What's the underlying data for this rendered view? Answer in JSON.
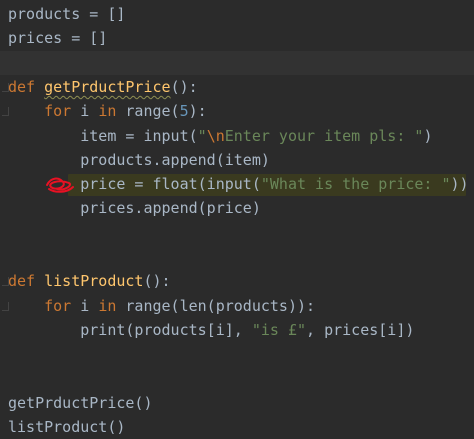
{
  "editor": {
    "lines": [
      {
        "id": "l1",
        "tokens": [
          {
            "t": "products = []",
            "c": "plain"
          }
        ]
      },
      {
        "id": "l2",
        "tokens": [
          {
            "t": "prices = []",
            "c": "plain"
          }
        ]
      },
      {
        "id": "l3",
        "tokens": []
      },
      {
        "id": "l4",
        "tokens": [
          {
            "t": "def ",
            "c": "kw"
          },
          {
            "t": "getPrductPrice",
            "c": "fn-underline"
          },
          {
            "t": "():",
            "c": "plain"
          }
        ]
      },
      {
        "id": "l5",
        "tokens": [
          {
            "t": "    for ",
            "c": "kw"
          },
          {
            "t": "i ",
            "c": "plain"
          },
          {
            "t": "in ",
            "c": "kw"
          },
          {
            "t": "range(",
            "c": "plain"
          },
          {
            "t": "5",
            "c": "num"
          },
          {
            "t": "):",
            "c": "plain"
          }
        ]
      },
      {
        "id": "l6",
        "tokens": [
          {
            "t": "        item = input(",
            "c": "plain"
          },
          {
            "t": "\"",
            "c": "str"
          },
          {
            "t": "\\n",
            "c": "esc"
          },
          {
            "t": "Enter your item pls: \"",
            "c": "str"
          },
          {
            "t": ")",
            "c": "plain"
          }
        ]
      },
      {
        "id": "l7",
        "tokens": [
          {
            "t": "        products.append(item)",
            "c": "plain"
          }
        ]
      },
      {
        "id": "l8",
        "tokens": [
          {
            "t": "        price = float(input(",
            "c": "plain"
          },
          {
            "t": "\"What is the price: \"",
            "c": "str"
          },
          {
            "t": "))",
            "c": "plain"
          }
        ]
      },
      {
        "id": "l9",
        "tokens": [
          {
            "t": "        prices.append(price)",
            "c": "plain"
          }
        ]
      },
      {
        "id": "l10",
        "tokens": []
      },
      {
        "id": "l11",
        "tokens": []
      },
      {
        "id": "l12",
        "tokens": [
          {
            "t": "def ",
            "c": "kw"
          },
          {
            "t": "listProduct",
            "c": "fn"
          },
          {
            "t": "():",
            "c": "plain"
          }
        ]
      },
      {
        "id": "l13",
        "tokens": [
          {
            "t": "    for ",
            "c": "kw"
          },
          {
            "t": "i ",
            "c": "plain"
          },
          {
            "t": "in ",
            "c": "kw"
          },
          {
            "t": "range(len(products)):",
            "c": "plain"
          }
        ]
      },
      {
        "id": "l14",
        "tokens": [
          {
            "t": "        print(products[i], ",
            "c": "plain"
          },
          {
            "t": "\"is £\"",
            "c": "str"
          },
          {
            "t": ", prices[i])",
            "c": "plain"
          }
        ]
      },
      {
        "id": "l15",
        "tokens": []
      },
      {
        "id": "l16",
        "tokens": []
      },
      {
        "id": "l17",
        "tokens": [
          {
            "t": "getPrductPrice()",
            "c": "plain"
          }
        ]
      },
      {
        "id": "l18",
        "tokens": [
          {
            "t": "listProduct()",
            "c": "plain"
          }
        ]
      }
    ]
  },
  "colors": {
    "background": "#2b2b2b",
    "keyword": "#cc7832",
    "function": "#ffc66d",
    "string": "#6a8759",
    "number": "#6897bb",
    "text": "#a9b7c6",
    "highlight_line": "#3a3a1f",
    "breakpoint_mark": "#e81123"
  }
}
